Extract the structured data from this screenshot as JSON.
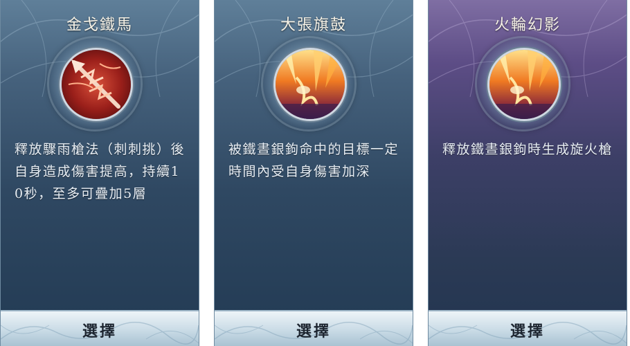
{
  "cards": [
    {
      "title": "金戈鐵馬",
      "icon": "spear-thrust-icon",
      "description": "釋放驟雨槍法（刺刺挑）後自身造成傷害提高，持續10秒，至多可疊加5層",
      "button_label": "選擇"
    },
    {
      "title": "大張旗鼓",
      "icon": "fire-burst-icon",
      "description": "被鐵晝銀鉤命中的目標一定時間內受自身傷害加深",
      "button_label": "選擇"
    },
    {
      "title": "火輪幻影",
      "icon": "fire-burst-icon",
      "description": "釋放鐵晝銀鉤時生成旋火槍",
      "button_label": "選擇"
    }
  ],
  "colors": {
    "card_blue_top": "#5f7f99",
    "card_blue_bottom": "#223a53",
    "card_purple_top": "#7f6ea3",
    "button_light": "#eef4f8",
    "text_light": "#e8eef4"
  }
}
